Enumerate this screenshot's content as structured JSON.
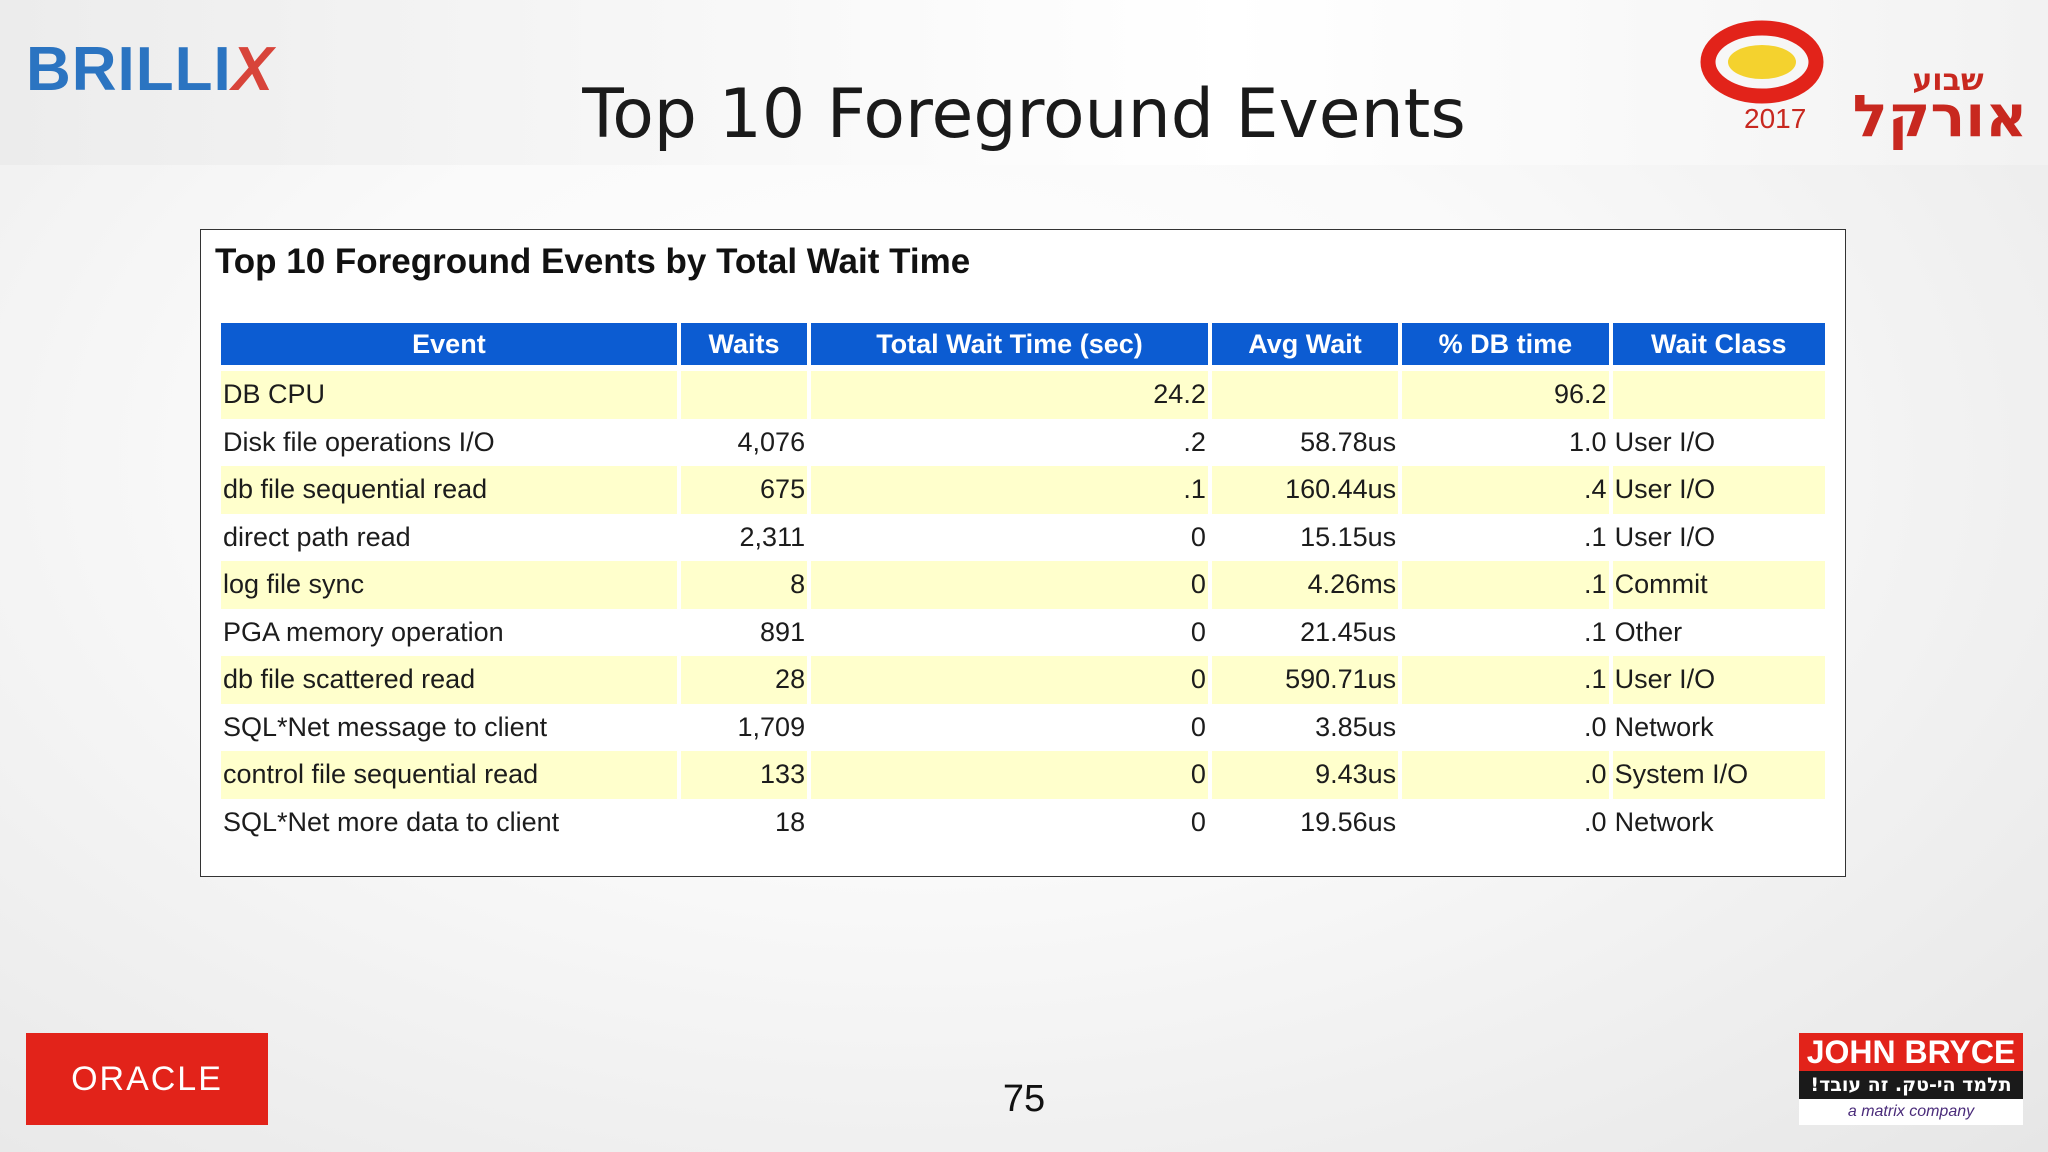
{
  "header": {
    "left_logo": {
      "text_main": "BRILLI",
      "text_x": "X"
    },
    "title": "Top 10 Foreground Events",
    "right_logo": {
      "year": "2017",
      "hebrew_top": "שבוע",
      "hebrew_main": "אורקל"
    }
  },
  "report": {
    "heading": "Top 10 Foreground Events by Total Wait Time",
    "columns": [
      "Event",
      "Waits",
      "Total Wait Time (sec)",
      "Avg Wait",
      "% DB time",
      "Wait Class"
    ],
    "rows": [
      [
        "DB CPU",
        "",
        "24.2",
        "",
        "96.2",
        ""
      ],
      [
        "Disk file operations I/O",
        "4,076",
        ".2",
        "58.78us",
        "1.0",
        "User I/O"
      ],
      [
        "db file sequential read",
        "675",
        ".1",
        "160.44us",
        ".4",
        "User I/O"
      ],
      [
        "direct path read",
        "2,311",
        "0",
        "15.15us",
        ".1",
        "User I/O"
      ],
      [
        "log file sync",
        "8",
        "0",
        "4.26ms",
        ".1",
        "Commit"
      ],
      [
        "PGA memory operation",
        "891",
        "0",
        "21.45us",
        ".1",
        "Other"
      ],
      [
        "db file scattered read",
        "28",
        "0",
        "590.71us",
        ".1",
        "User I/O"
      ],
      [
        "SQL*Net message to client",
        "1,709",
        "0",
        "3.85us",
        ".0",
        "Network"
      ],
      [
        "control file sequential read",
        "133",
        "0",
        "9.43us",
        ".0",
        "System I/O"
      ],
      [
        "SQL*Net more data to client",
        "18",
        "0",
        "19.56us",
        ".0",
        "Network"
      ]
    ]
  },
  "footer": {
    "oracle_logo": "ORACLE",
    "page_number": "75",
    "jb_logo": {
      "top": "JOHN BRYCE",
      "middle": "תלמד הי-טק. זה עובד!",
      "bottom": "a matrix company"
    }
  },
  "colors": {
    "header_blue": "#0c5cd2",
    "row_yellow": "#ffffcc",
    "brillix_blue": "#2b74c1",
    "oracle_red": "#e2231a"
  }
}
